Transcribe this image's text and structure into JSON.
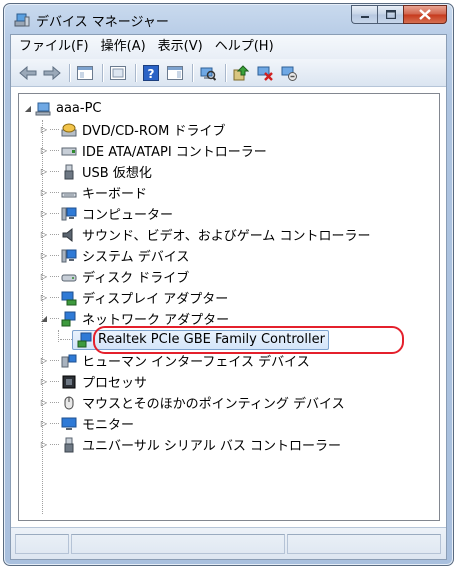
{
  "window": {
    "title": "デバイス マネージャー",
    "icon": "device-manager-icon"
  },
  "menu": {
    "items": [
      "ファイル(F)",
      "操作(A)",
      "表示(V)",
      "ヘルプ(H)"
    ]
  },
  "toolbar": {
    "buttons": [
      "back-arrow-icon",
      "forward-arrow-icon",
      "show-hide-console-tree-icon",
      "properties-icon",
      "help-icon",
      "action-pane-icon",
      "scan-hardware-icon",
      "update-driver-icon",
      "disable-device-icon",
      "uninstall-device-icon"
    ]
  },
  "tree": {
    "root": {
      "label": "aaa-PC",
      "expanded": true,
      "icon": "computer-icon"
    },
    "nodes": [
      {
        "label": "DVD/CD-ROM ドライブ",
        "icon": "dvd-drive-icon",
        "expanded": false
      },
      {
        "label": "IDE ATA/ATAPI コントローラー",
        "icon": "ide-controller-icon",
        "expanded": false
      },
      {
        "label": "USB 仮想化",
        "icon": "usb-icon",
        "expanded": false
      },
      {
        "label": "キーボード",
        "icon": "keyboard-icon",
        "expanded": false
      },
      {
        "label": "コンピューター",
        "icon": "computer-icon",
        "expanded": false
      },
      {
        "label": "サウンド、ビデオ、およびゲーム コントローラー",
        "icon": "speaker-icon",
        "expanded": false
      },
      {
        "label": "システム デバイス",
        "icon": "system-device-icon",
        "expanded": false
      },
      {
        "label": "ディスク ドライブ",
        "icon": "disk-drive-icon",
        "expanded": false
      },
      {
        "label": "ディスプレイ アダプター",
        "icon": "display-adapter-icon",
        "expanded": false
      },
      {
        "label": "ネットワーク アダプター",
        "icon": "network-adapter-icon",
        "expanded": true,
        "children": [
          {
            "label": "Realtek PCIe GBE Family Controller",
            "icon": "network-card-icon",
            "selected": true
          }
        ]
      },
      {
        "label": "ヒューマン インターフェイス デバイス",
        "icon": "hid-icon",
        "expanded": false
      },
      {
        "label": "プロセッサ",
        "icon": "processor-icon",
        "expanded": false
      },
      {
        "label": "マウスとそのほかのポインティング デバイス",
        "icon": "mouse-icon",
        "expanded": false
      },
      {
        "label": "モニター",
        "icon": "monitor-icon",
        "expanded": false
      },
      {
        "label": "ユニバーサル シリアル バス コントローラー",
        "icon": "usb-controller-icon",
        "expanded": false
      }
    ]
  },
  "colors": {
    "highlight_ring": "#e4202c",
    "selection": "#d4e5f9",
    "frame": "#b9cde7"
  }
}
